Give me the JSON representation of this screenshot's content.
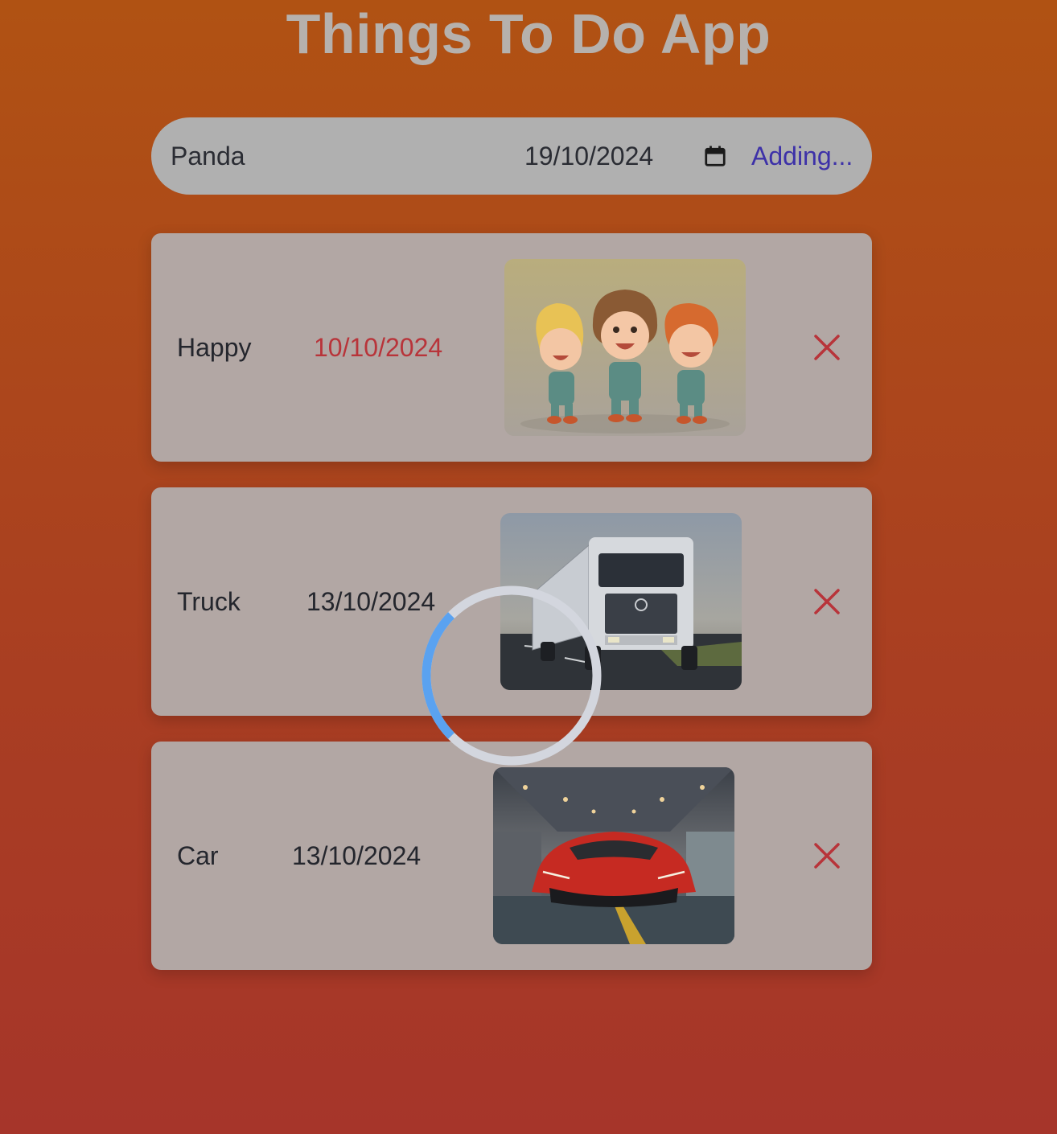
{
  "app": {
    "title": "Things To Do App"
  },
  "add_form": {
    "name_value": "Panda",
    "date_value": "19/10/2024",
    "add_button_label": "Adding...",
    "calendar_icon": "calendar-icon"
  },
  "todos": [
    {
      "name": "Happy",
      "date": "10/10/2024",
      "overdue": true,
      "image": "three cartoon kids",
      "delete_icon": "close-icon"
    },
    {
      "name": "Truck",
      "date": "13/10/2024",
      "overdue": false,
      "image": "white semi truck",
      "delete_icon": "close-icon"
    },
    {
      "name": "Car",
      "date": "13/10/2024",
      "overdue": false,
      "image": "red sports car",
      "delete_icon": "close-icon"
    }
  ],
  "loading": {
    "progress_fraction": 0.25
  },
  "colors": {
    "overdue_date": "#b8343a",
    "delete_icon": "#b8343a",
    "add_button": "#3d31a8",
    "spinner_track": "#d3d6de",
    "spinner_arc": "#5aa2f0"
  }
}
